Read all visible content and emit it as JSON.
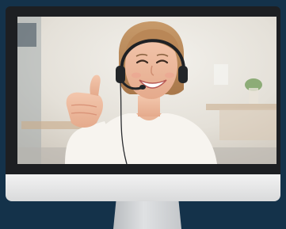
{
  "scene": {
    "subject": "woman-with-headset-thumbs-up",
    "colors": {
      "background": "#14324a",
      "bezel": "#1d1f22",
      "chin": "#e6e7e8",
      "stand": "#cfd2d4"
    }
  }
}
